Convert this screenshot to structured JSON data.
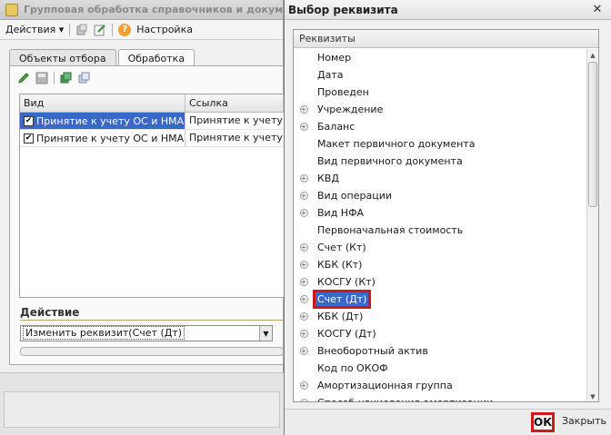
{
  "bg_window": {
    "title": "Групповая обработка справочников и документ",
    "toolbar": {
      "actions_label": "Действия",
      "settings_label": "Настройка"
    },
    "tabs": [
      {
        "label": "Объекты отбора",
        "active": false
      },
      {
        "label": "Обработка",
        "active": true
      }
    ],
    "grid": {
      "columns": [
        "Вид",
        "Ссылка"
      ],
      "rows": [
        {
          "checked": true,
          "vid": "Принятие к учету ОС и НМА",
          "link": "Принятие к учету ОС",
          "selected": true
        },
        {
          "checked": true,
          "vid": "Принятие к учету ОС и НМА",
          "link": "Принятие к учету ОС",
          "selected": false
        }
      ]
    },
    "action": {
      "label": "Действие",
      "value": "Изменить реквизит(Счет (Дт)"
    }
  },
  "dialog": {
    "title": "Выбор реквизита",
    "column_header": "Реквизиты",
    "items": [
      {
        "label": "Номер",
        "expandable": false
      },
      {
        "label": "Дата",
        "expandable": false
      },
      {
        "label": "Проведен",
        "expandable": false
      },
      {
        "label": "Учреждение",
        "expandable": true
      },
      {
        "label": "Баланс",
        "expandable": true
      },
      {
        "label": "Макет первичного документа",
        "expandable": false
      },
      {
        "label": "Вид первичного документа",
        "expandable": false
      },
      {
        "label": "КВД",
        "expandable": true
      },
      {
        "label": "Вид операции",
        "expandable": true
      },
      {
        "label": "Вид НФА",
        "expandable": true
      },
      {
        "label": "Первоначальная стоимость",
        "expandable": false
      },
      {
        "label": "Счет (Кт)",
        "expandable": true
      },
      {
        "label": "КБК (Кт)",
        "expandable": true
      },
      {
        "label": "КОСГУ (Кт)",
        "expandable": true
      },
      {
        "label": "Счет (Дт)",
        "expandable": true,
        "selected": true
      },
      {
        "label": "КБК (Дт)",
        "expandable": true
      },
      {
        "label": "КОСГУ (Дт)",
        "expandable": true
      },
      {
        "label": "Внеоборотный актив",
        "expandable": true
      },
      {
        "label": "Код по ОКОФ",
        "expandable": false
      },
      {
        "label": "Амортизационная группа",
        "expandable": true
      },
      {
        "label": "Способ начисления амортизации",
        "expandable": true
      }
    ],
    "ok_label": "ОК",
    "close_label": "Закрыть"
  },
  "colors": {
    "selection": "#3968c8",
    "highlight_border": "#d01818"
  }
}
